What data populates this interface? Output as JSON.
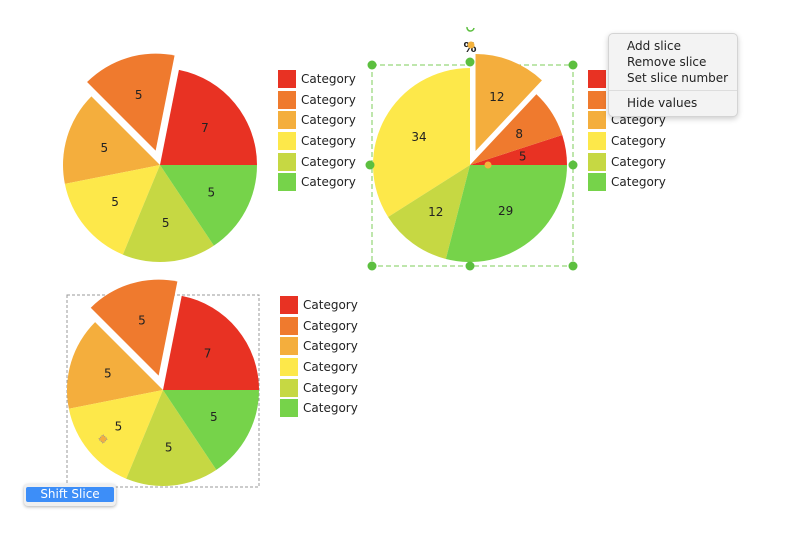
{
  "colors": [
    "#e83223",
    "#ef7a2e",
    "#f4ae3d",
    "#fde84a",
    "#c6d843",
    "#76d34a"
  ],
  "chart_data": [
    {
      "type": "pie",
      "values": [
        7,
        5,
        5,
        5,
        5,
        5
      ],
      "exploded": 1,
      "legend": [
        "Category",
        "Category",
        "Category",
        "Category",
        "Category",
        "Category"
      ],
      "legend_placement": "right"
    },
    {
      "type": "pie",
      "values": [
        5,
        8,
        12,
        34,
        12,
        29
      ],
      "exploded": 2,
      "legend": [
        "Category",
        "Category",
        "Category",
        "Category",
        "Category",
        "Category"
      ],
      "legend_placement": "right",
      "unit_label": "%"
    },
    {
      "type": "pie",
      "values": [
        7,
        5,
        5,
        5,
        5,
        5
      ],
      "exploded": 1,
      "legend": [
        "Category",
        "Category",
        "Category",
        "Category",
        "Category",
        "Category"
      ],
      "legend_placement": "right"
    }
  ],
  "context_menu": {
    "items": [
      "Add slice",
      "Remove slice",
      "Set slice number"
    ],
    "extra": "Hide values"
  },
  "shift_button": "Shift Slice"
}
